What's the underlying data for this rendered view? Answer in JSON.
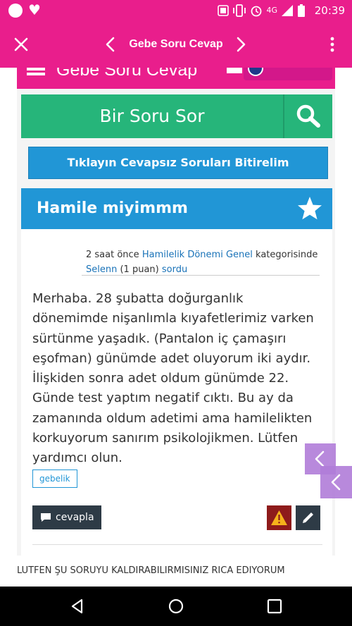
{
  "status_bar": {
    "time": "20:39",
    "icons": [
      "circle-icon",
      "heart-icon",
      "volte-icon",
      "vibrate-icon",
      "alarm-icon",
      "signal-icon",
      "battery-icon"
    ],
    "network_label": "4G"
  },
  "toolbar": {
    "title": "Gebe Soru Cevap"
  },
  "site": {
    "name": "Gebe Soru Cevap",
    "ask_label": "Bir Soru Sor",
    "unanswered_label": "Tıklayın Cevapsız Soruları Bitirelim",
    "question_title": "Hamile miyimmm",
    "meta": {
      "time": "2 saat önce",
      "category": "Hamilelik Dönemi Genel",
      "category_suffix": "kategorisinde",
      "user": "Selenn",
      "points": "(1 puan)",
      "action": "sordu"
    },
    "body": "Merhaba. 28 şubatta doğurganlık dönemimde nişanlımla kıyafetlerimiz varken sürtünme yaşadık. (Pantalon iç çamaşırı eşofman) günümde adet oluyorum iki aydır. İlişkiden sonra adet oldum günümde 22. Günde test yaptım negatif cıktı. Bu ay da zamanında oldum adetimi ama hamilelikten korkuyorum sanırım psikolojikmen. Lütfen yardımcı olun.",
    "tag": "gebelik",
    "reply_label": "cevapla"
  },
  "caption": "LUTFEN ŞU SORUYU KALDIRABILIRMISINIZ RICA EDIYORUM",
  "colors": {
    "brand_pink": "#e91e8c",
    "green": "#26b57a",
    "blue": "#2196d6",
    "dark": "#2e3b46",
    "warn": "#8e1b1b",
    "purple_overlay": "#b17dd9"
  }
}
